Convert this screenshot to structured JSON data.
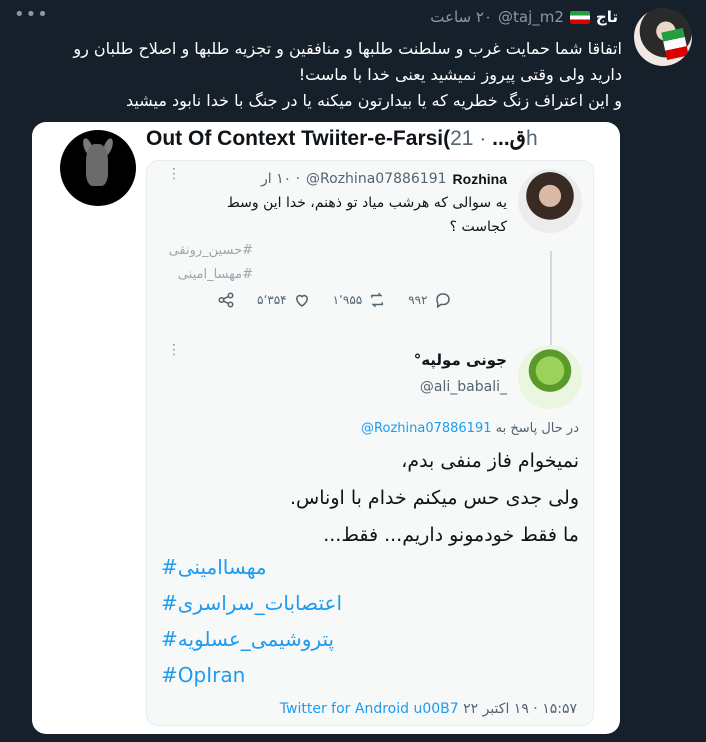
{
  "top_tweet": {
    "more": "•••",
    "name": "تاج",
    "handle": "@taj_m2",
    "time": "۲۰ ساعت",
    "lines": [
      "اتفاقا شما حمایت غرب و سلطنت طلبها و منافقین و تجزیه طلبها و اصلاح طلبان رو",
      "دارید ولی وقتی پیروز نمیشید یعنی خدا با ماست!",
      "و این اعتراف زنگ خطریه که یا بیدارتون میکنه یا در جنگ با خدا نابود میشید"
    ]
  },
  "card": {
    "title": "Out Of Context Twiiter-e-Farsi(ق...",
    "time": "· 21h",
    "reply": {
      "name": "Rozhina",
      "handle": "@Rozhina07886191",
      "time": "· ۱۰ ار",
      "text": "یه سوالی که هرشب میاد تو ذهنم، خدا این وسط کجاست ؟",
      "tags": [
        "#حسین_رونقی",
        "#مهسا_امینی"
      ],
      "replies": "۹۹۲",
      "retweets": "۱٬۹۵۵",
      "likes": "۵٬۳۵۴"
    },
    "answer": {
      "name": "ﺟﻮﻧﯽ ﻣﻮﻟﭙﻪ°",
      "handle": "@ali_babali_",
      "reply_prefix": "در حال پاسخ به",
      "reply_handle": "@Rozhina07886191",
      "lines": [
        "نمیخوام فاز منفی بدم،",
        "ولی جدی حس میکنم خدام با اوناس.",
        "ما فقط خودمونو داریم... فقط..."
      ],
      "tags": [
        "#مهساامینی",
        "#اعتصابات_سراسری",
        "#پتروشیمی_عسلویه",
        "#OpIran"
      ],
      "footer_time": "۱۵:۵۷ · ۱۹ اکتبر ۲۲",
      "footer_source": "Twitter for Android u00B7"
    }
  }
}
